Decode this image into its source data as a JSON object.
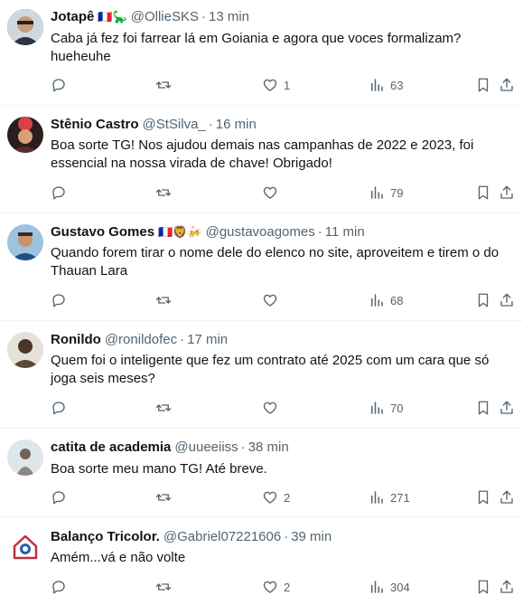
{
  "tweets": [
    {
      "name": "Jotapê",
      "flags": "🇫🇷🦕",
      "handle": "@OllieSKS",
      "time": "13 min",
      "text": "Caba já fez foi farrear lá em Goiania e agora que voces formalizam? hueheuhe",
      "likes": "1",
      "views": "63",
      "avatar_color": "#3b4a5a"
    },
    {
      "name": "Stênio Castro",
      "flags": "",
      "handle": "@StSilva_",
      "time": "16 min",
      "text": "Boa sorte TG! Nos ajudou demais nas campanhas de 2022 e 2023, foi essencial na nossa virada de chave! Obrigado!",
      "likes": "",
      "views": "79",
      "avatar_color": "#7a2a2a"
    },
    {
      "name": "Gustavo Gomes",
      "flags": "🇫🇷🦁🍻",
      "handle": "@gustavoagomes",
      "time": "11 min",
      "text": "Quando forem tirar o nome dele do elenco no site, aproveitem e tirem o do Thauan Lara",
      "likes": "",
      "views": "68",
      "avatar_color": "#2d5d8a"
    },
    {
      "name": "Ronildo",
      "flags": "",
      "handle": "@ronildofec",
      "time": "17 min",
      "text": "Quem foi o inteligente que fez um contrato até 2025 com um cara que só joga seis meses?",
      "likes": "",
      "views": "70",
      "avatar_color": "#6b5a45"
    },
    {
      "name": "catita de academia",
      "flags": "",
      "handle": "@uueeiiss",
      "time": "38 min",
      "text": "Boa sorte meu mano TG! Até breve.",
      "likes": "2",
      "views": "271",
      "avatar_color": "#9aa6ad"
    },
    {
      "name": "Balanço Tricolor.",
      "flags": "",
      "handle": "@Gabriel07221606",
      "time": "39 min",
      "text": "Amém...vá e não volte",
      "likes": "2",
      "views": "304",
      "avatar_color": "#e8eef5"
    }
  ],
  "sep": "·",
  "colors": {
    "text": "#0f1419",
    "muted": "#536471",
    "divider": "#eff3f4"
  }
}
